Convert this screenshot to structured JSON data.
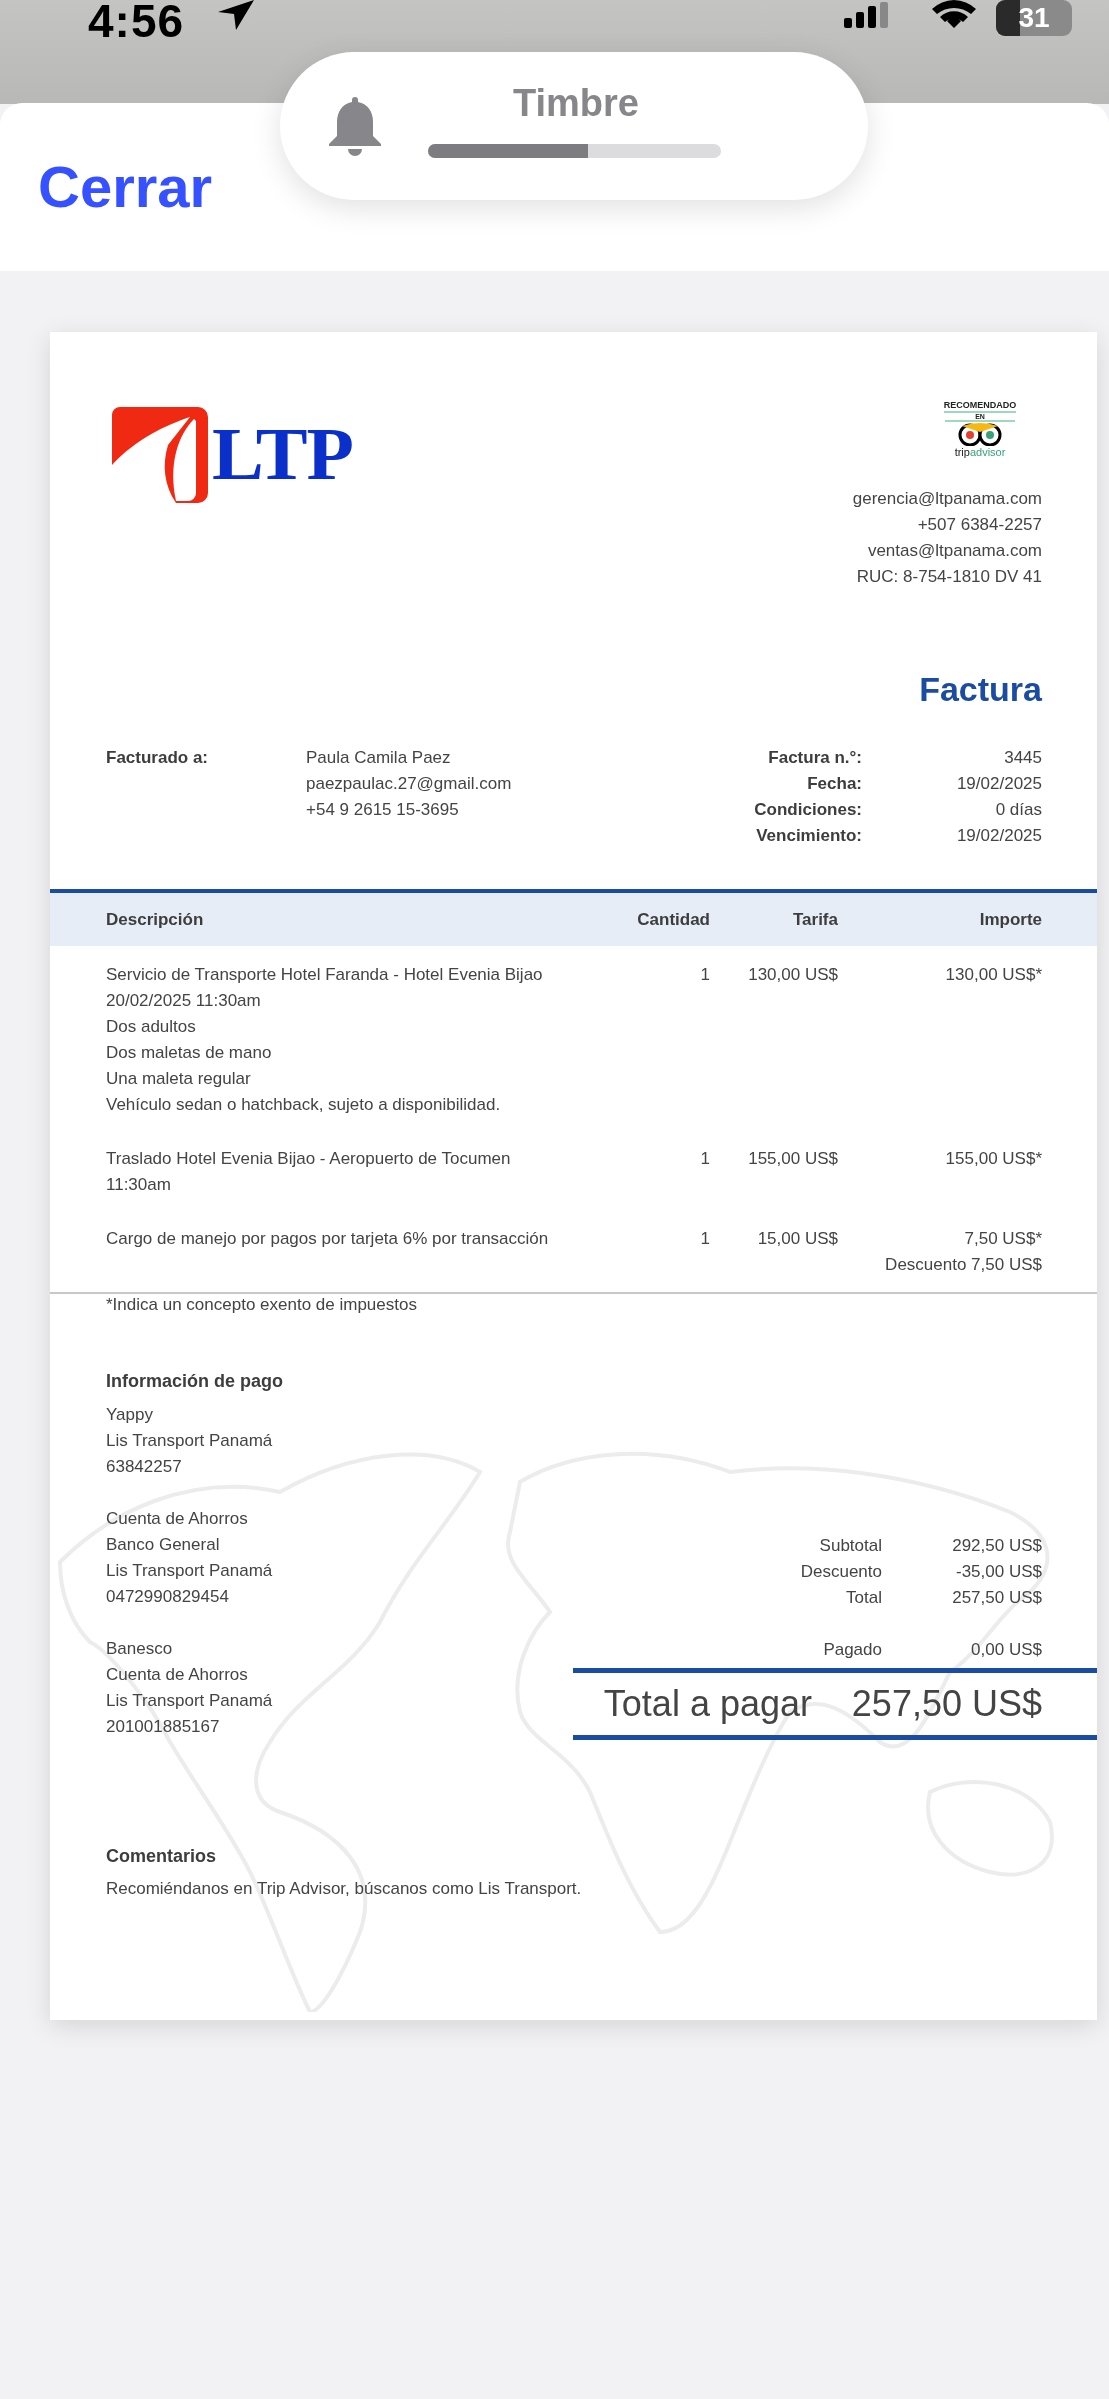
{
  "status_bar": {
    "time": "4:56",
    "battery": "31"
  },
  "ringer_banner": {
    "label": "Timbre",
    "level": 0.545
  },
  "header": {
    "close_button": "Cerrar"
  },
  "invoice": {
    "logo": {
      "text": "LTP"
    },
    "badge": {
      "top": "RECOMENDADO",
      "middle": "EN",
      "brand_prefix": "trip",
      "brand_suffix": "advisor"
    },
    "contact": [
      "gerencia@ltpanama.com",
      "+507 6384-2257",
      "ventas@ltpanama.com",
      "RUC: 8-754-1810 DV 41"
    ],
    "title": "Factura",
    "billed_to": {
      "label": "Facturado a:",
      "lines": [
        "Paula Camila Paez",
        "paezpaulac.27@gmail.com",
        "+54 9 2615 15-3695"
      ]
    },
    "meta": [
      {
        "label": "Factura n.°:",
        "value": "3445"
      },
      {
        "label": "Fecha:",
        "value": "19/02/2025"
      },
      {
        "label": "Condiciones:",
        "value": "0 días"
      },
      {
        "label": "Vencimiento:",
        "value": "19/02/2025"
      }
    ],
    "table": {
      "columns": [
        "Descripción",
        "Cantidad",
        "Tarifa",
        "Importe"
      ],
      "rows": [
        {
          "description": [
            "Servicio de Transporte Hotel Faranda - Hotel Evenia Bijao",
            "20/02/2025 11:30am",
            "Dos adultos",
            "Dos maletas de mano",
            "Una maleta regular",
            "Vehículo sedan o hatchback, sujeto a disponibilidad."
          ],
          "quantity": "1",
          "rate": "130,00 US$",
          "amount": [
            "130,00 US$*"
          ]
        },
        {
          "description": [
            "Traslado Hotel Evenia Bijao - Aeropuerto de Tocumen",
            "11:30am"
          ],
          "quantity": "1",
          "rate": "155,00 US$",
          "amount": [
            "155,00 US$*"
          ]
        },
        {
          "description": [
            "Cargo de manejo por pagos por tarjeta 6% por transacción"
          ],
          "quantity": "1",
          "rate": "15,00 US$",
          "amount": [
            "7,50 US$*",
            "Descuento 7,50 US$"
          ]
        }
      ]
    },
    "footnote": "*Indica un concepto exento de impuestos",
    "payment": {
      "heading": "Información de pago",
      "groups": [
        [
          "Yappy",
          "Lis Transport Panamá",
          "63842257"
        ],
        [
          "Cuenta de Ahorros",
          "Banco General",
          "Lis Transport Panamá",
          "0472990829454"
        ],
        [
          "Banesco",
          "Cuenta de Ahorros",
          "Lis Transport Panamá",
          "201001885167"
        ]
      ]
    },
    "totals": [
      {
        "label": "Subtotal",
        "value": "292,50 US$"
      },
      {
        "label": "Descuento",
        "value": "-35,00 US$"
      },
      {
        "label": "Total",
        "value": "257,50 US$"
      }
    ],
    "paid": {
      "label": "Pagado",
      "value": "0,00 US$"
    },
    "amount_due": {
      "label": "Total a pagar",
      "value": "257,50 US$"
    },
    "comments": {
      "heading": "Comentarios",
      "text": "Recomiéndanos en Trip Advisor, búscanos como Lis Transport."
    }
  }
}
